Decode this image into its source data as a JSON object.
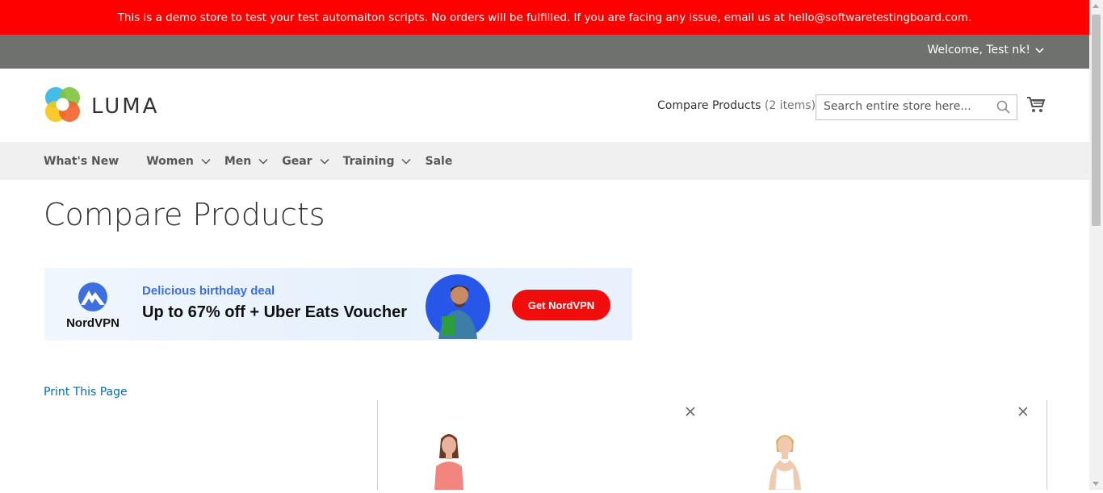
{
  "demo_notice": "This is a demo store to test your test automaiton scripts. No orders will be fulfilled. If you are facing any issue, email us at hello@softwaretestingboard.com.",
  "header_panel": {
    "welcome": "Welcome, Test nk!"
  },
  "logo": {
    "text": "LUMA"
  },
  "compare_link": {
    "label": "Compare Products",
    "count": "(2 items)"
  },
  "search": {
    "placeholder": "Search entire store here..."
  },
  "nav": {
    "items": [
      {
        "label": "What's New",
        "has_submenu": false
      },
      {
        "label": "Women",
        "has_submenu": true
      },
      {
        "label": "Men",
        "has_submenu": true
      },
      {
        "label": "Gear",
        "has_submenu": true
      },
      {
        "label": "Training",
        "has_submenu": true
      },
      {
        "label": "Sale",
        "has_submenu": false
      }
    ]
  },
  "page_title": "Compare Products",
  "ad": {
    "brand": "NordVPN",
    "subheading": "Delicious birthday deal",
    "headline": "Up to 67% off + Uber Eats Voucher",
    "cta": "Get NordVPN"
  },
  "print_link": "Print This Page",
  "colors": {
    "demo_bar": "#ff0000",
    "header_panel": "#6e716e",
    "nav_bg": "#f0f0f0",
    "link": "#006bb4",
    "ad_cta": "#f20d0d"
  }
}
